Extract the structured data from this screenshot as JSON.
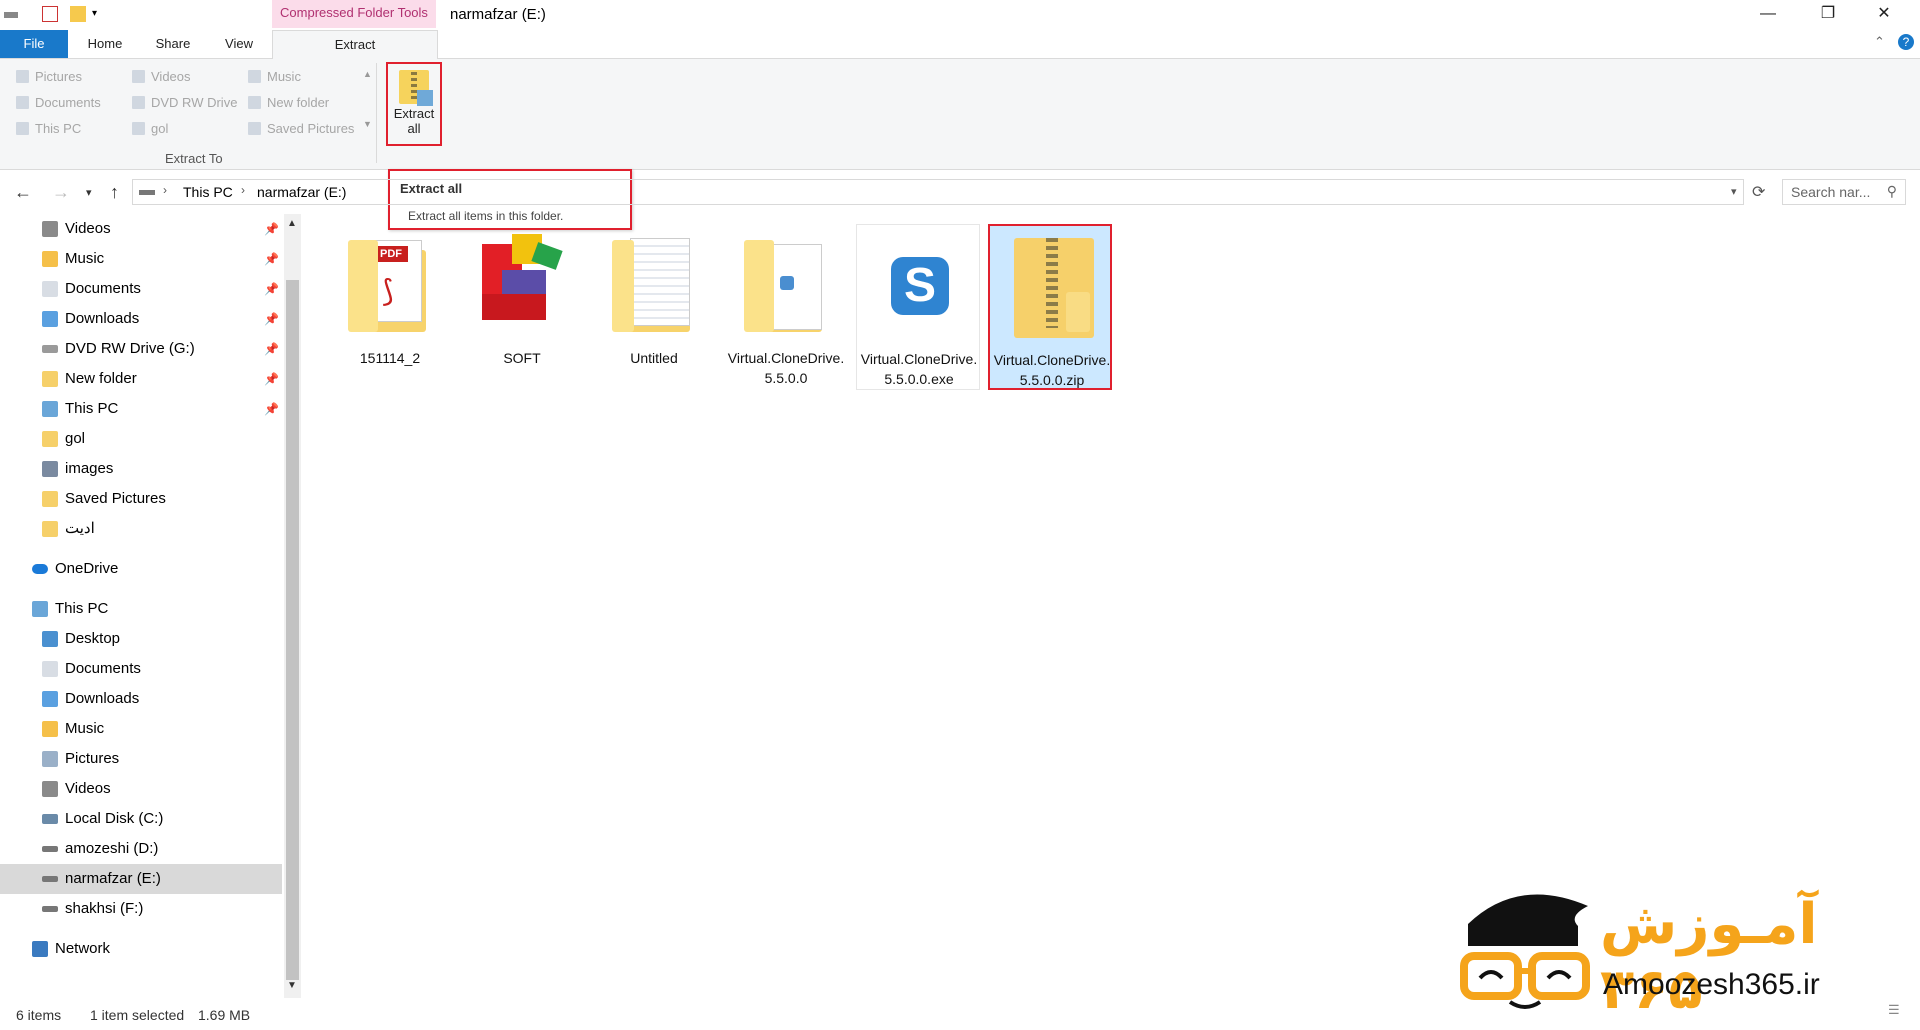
{
  "window": {
    "title": "narmafzar (E:)",
    "context_tab": "Compressed Folder Tools",
    "controls": {
      "minimize": "—",
      "maximize": "❐",
      "close": "✕"
    }
  },
  "tabs": [
    {
      "label": "File"
    },
    {
      "label": "Home"
    },
    {
      "label": "Share"
    },
    {
      "label": "View"
    },
    {
      "label": "Extract"
    }
  ],
  "ribbon": {
    "extract_to": {
      "items": [
        "Pictures",
        "Videos",
        "Music",
        "Documents",
        "DVD RW Drive",
        "New folder",
        "This PC",
        "gol",
        "Saved Pictures"
      ],
      "group_label": "Extract To"
    },
    "extract_all_label_1": "Extract",
    "extract_all_label_2": "all"
  },
  "tooltip": {
    "title": "Extract all",
    "description": "Extract all items in this folder."
  },
  "address": {
    "crumbs": [
      "This PC",
      "narmafzar (E:)"
    ],
    "search_placeholder": "Search nar..."
  },
  "nav": {
    "quick_access": [
      {
        "label": "Videos",
        "icon": "videos-icon"
      },
      {
        "label": "Music",
        "icon": "music-icon"
      },
      {
        "label": "Documents",
        "icon": "documents-icon"
      },
      {
        "label": "Downloads",
        "icon": "downloads-icon"
      },
      {
        "label": "DVD RW Drive (G:)",
        "icon": "dvd-icon"
      },
      {
        "label": "New folder",
        "icon": "folder-icon"
      },
      {
        "label": "This PC",
        "icon": "pc-icon"
      },
      {
        "label": "gol",
        "icon": "folder-icon"
      },
      {
        "label": "images",
        "icon": "images-icon"
      },
      {
        "label": "Saved Pictures",
        "icon": "folder-icon"
      },
      {
        "label": "ادیت",
        "icon": "folder-icon"
      }
    ],
    "onedrive": "OneDrive",
    "this_pc": "This PC",
    "pc_items": [
      {
        "label": "Desktop"
      },
      {
        "label": "Documents"
      },
      {
        "label": "Downloads"
      },
      {
        "label": "Music"
      },
      {
        "label": "Pictures"
      },
      {
        "label": "Videos"
      },
      {
        "label": "Local Disk (C:)"
      },
      {
        "label": "amozeshi (D:)"
      },
      {
        "label": "narmafzar (E:)"
      },
      {
        "label": "shakhsi (F:)"
      }
    ],
    "network": "Network"
  },
  "files": [
    {
      "name": "151114_2",
      "type": "pdf-folder"
    },
    {
      "name": "SOFT",
      "type": "app"
    },
    {
      "name": "Untitled",
      "type": "folder"
    },
    {
      "name": "Virtual.CloneDrive.5.5.0.0",
      "type": "folder"
    },
    {
      "name": "Virtual.CloneDrive.5.5.0.0.exe",
      "type": "exe"
    },
    {
      "name": "Virtual.CloneDrive.5.5.0.0.zip",
      "type": "zip",
      "selected": true
    }
  ],
  "status": {
    "count": "6 items",
    "selected": "1 item selected",
    "size": "1.69 MB"
  },
  "watermark": {
    "brand": "آمـوزش ۳۶۵",
    "site": "Amoozesh365.ir"
  },
  "colors": {
    "file_tab": "#1979ca",
    "highlight": "#e0202e",
    "selection": "#cce8ff",
    "brand": "#f5a41b"
  }
}
